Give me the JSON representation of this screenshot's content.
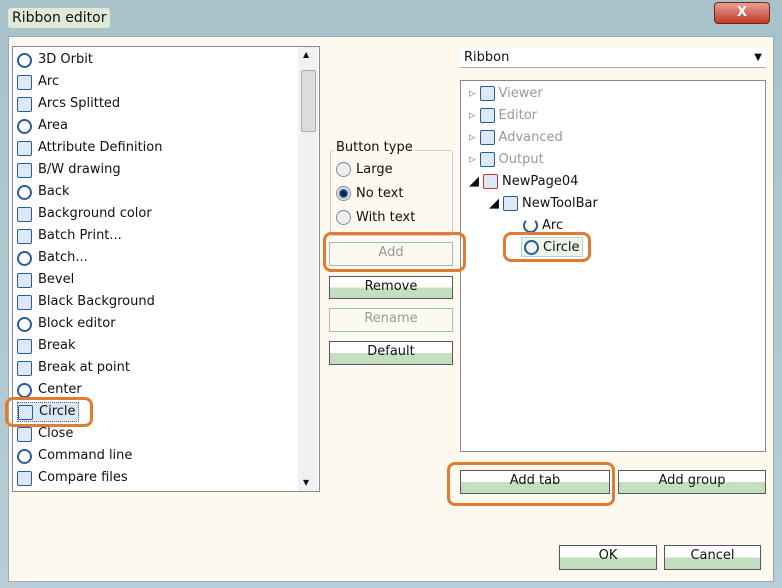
{
  "window": {
    "title": "Ribbon editor",
    "close": "X"
  },
  "commands": [
    "3D Orbit",
    "Arc",
    "Arcs Splitted",
    "Area",
    "Attribute Definition",
    "B/W drawing",
    "Back",
    "Background color",
    "Batch Print...",
    "Batch...",
    "Bevel",
    "Black Background",
    "Block editor",
    "Break",
    "Break at point",
    "Center",
    "Circle",
    "Close",
    "Command line",
    "Compare files"
  ],
  "selected_command": "Circle",
  "button_type": {
    "label": "Button type",
    "options": [
      "Large",
      "No text",
      "With text"
    ],
    "selected": "No text"
  },
  "actions": {
    "add": "Add",
    "remove": "Remove",
    "rename": "Rename",
    "default": "Default"
  },
  "ribbon_select": "Ribbon",
  "tree": {
    "pages": [
      "Viewer",
      "Editor",
      "Advanced",
      "Output"
    ],
    "new_page": "NewPage04",
    "toolbar": "NewToolBar",
    "items": [
      "Arc",
      "Circle"
    ]
  },
  "bottom": {
    "add_tab": "Add tab",
    "add_group": "Add group",
    "ok": "OK",
    "cancel": "Cancel"
  },
  "colors": {
    "annotation": "#e07b30",
    "button_green": "#c4dfc0"
  }
}
